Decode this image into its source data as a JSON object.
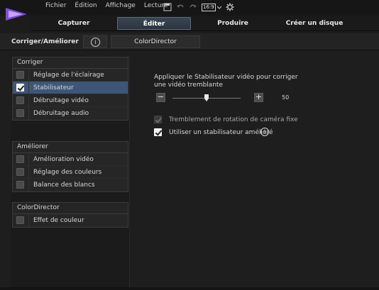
{
  "menu": [
    "Fichier",
    "Édition",
    "Affichage",
    "Lecture"
  ],
  "toolbar": {
    "aspect_ratio": "16:9"
  },
  "tabs": [
    {
      "label": "Capturer",
      "active": false
    },
    {
      "label": "Éditer",
      "active": true
    },
    {
      "label": "Produire",
      "active": false
    },
    {
      "label": "Créer un disque",
      "active": false
    }
  ],
  "subheader": {
    "title": "Corriger/Améliorer",
    "info_symbol": "i",
    "colordirector_tab": "ColorDirector"
  },
  "groups": {
    "corriger": {
      "title": "Corriger",
      "items": [
        {
          "label": "Réglage de l'éclairage",
          "checked": false,
          "selected": false
        },
        {
          "label": "Stabilisateur",
          "checked": true,
          "selected": true
        },
        {
          "label": "Débruitage vidéo",
          "checked": false,
          "selected": false
        },
        {
          "label": "Débruitage audio",
          "checked": false,
          "selected": false
        }
      ]
    },
    "ameliorer": {
      "title": "Améliorer",
      "items": [
        {
          "label": "Amélioration vidéo",
          "checked": false
        },
        {
          "label": "Réglage des couleurs",
          "checked": false
        },
        {
          "label": "Balance des blancs",
          "checked": false
        }
      ]
    },
    "colordirector": {
      "title": "ColorDirector",
      "items": [
        {
          "label": "Effet de couleur",
          "checked": false
        }
      ]
    }
  },
  "stabilizer": {
    "description": "Appliquer le Stabilisateur vidéo pour corriger une vidéo tremblante",
    "minus": "−",
    "plus": "+",
    "value": "50",
    "value_min": 0,
    "value_max": 100,
    "option_rotation": {
      "label": "Tremblement de rotation de caméra fixe",
      "checked": true,
      "enabled": false
    },
    "option_enhanced": {
      "label": "Utiliser un stabilisateur amélioré",
      "checked": true,
      "enabled": true
    },
    "help_symbol": "i"
  },
  "colors": {
    "accent_selected": "#3d5678",
    "active_tab": "#3a4652",
    "background": "#1e1e1e"
  }
}
